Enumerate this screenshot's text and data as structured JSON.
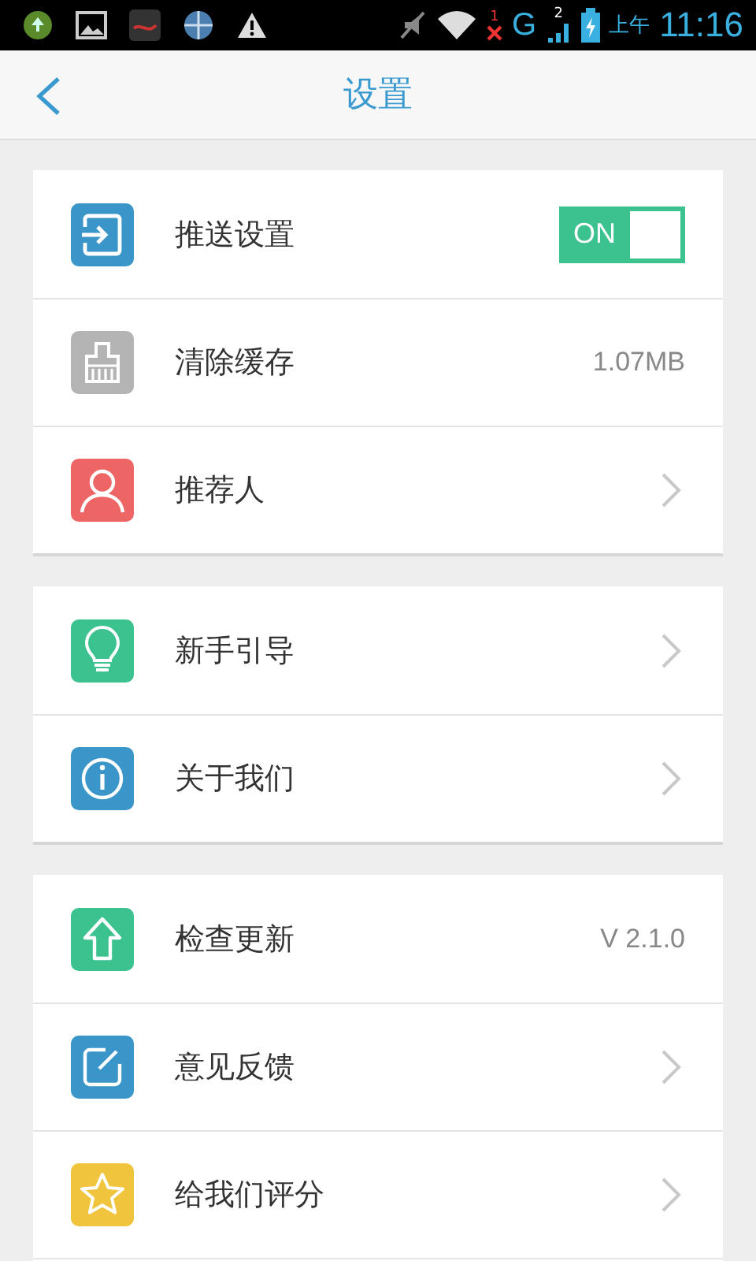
{
  "status_bar": {
    "sim1_badge": "1",
    "network": "G",
    "sim2_badge": "2",
    "period": "上午",
    "time": "11:16"
  },
  "header": {
    "title": "设置"
  },
  "groups": [
    {
      "items": [
        {
          "label": "推送设置",
          "kind": "toggle",
          "color": "#3a96c8",
          "toggle": {
            "on": true,
            "label": "ON"
          }
        },
        {
          "label": "清除缓存",
          "kind": "value",
          "color": "#b4b4b4",
          "value": "1.07MB"
        },
        {
          "label": "推荐人",
          "kind": "link",
          "color": "#ee6565"
        }
      ]
    },
    {
      "items": [
        {
          "label": "新手引导",
          "kind": "link",
          "color": "#3cc28e"
        },
        {
          "label": "关于我们",
          "kind": "link",
          "color": "#3a96c8"
        }
      ]
    },
    {
      "items": [
        {
          "label": "检查更新",
          "kind": "value",
          "color": "#3cc28e",
          "value": "V 2.1.0"
        },
        {
          "label": "意见反馈",
          "kind": "link",
          "color": "#3a96c8"
        },
        {
          "label": "给我们评分",
          "kind": "link",
          "color": "#f0c43c"
        },
        {
          "kind": "blank"
        }
      ]
    }
  ]
}
